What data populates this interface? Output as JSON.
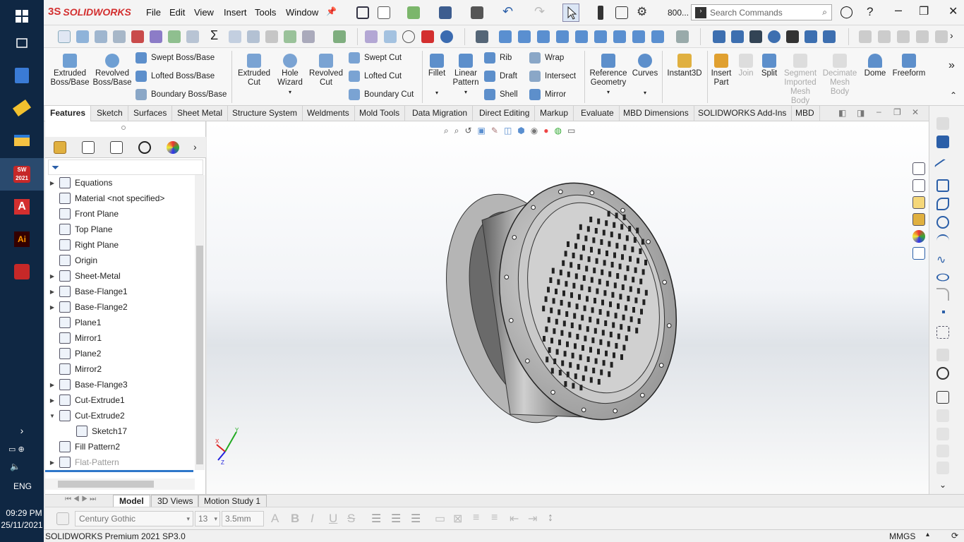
{
  "app": {
    "brand": "SOLIDWORKS",
    "edition_status": "SOLIDWORKS Premium 2021 SP3.0"
  },
  "menu": [
    "File",
    "Edit",
    "View",
    "Insert",
    "Tools",
    "Window"
  ],
  "titlebar": {
    "zoom": "800...",
    "search_placeholder": "Search Commands"
  },
  "ribbon": {
    "extruded_boss": "Extruded Boss/Base",
    "revolved_boss": "Revolved Boss/Base",
    "swept_boss": "Swept Boss/Base",
    "lofted_boss": "Lofted Boss/Base",
    "boundary_boss": "Boundary Boss/Base",
    "extruded_cut": "Extruded Cut",
    "hole_wizard": "Hole Wizard",
    "revolved_cut": "Revolved Cut",
    "swept_cut": "Swept Cut",
    "lofted_cut": "Lofted Cut",
    "boundary_cut": "Boundary Cut",
    "fillet": "Fillet",
    "linear_pattern": "Linear Pattern",
    "rib": "Rib",
    "draft": "Draft",
    "shell": "Shell",
    "wrap": "Wrap",
    "intersect": "Intersect",
    "mirror": "Mirror",
    "reference_geometry": "Reference Geometry",
    "curves": "Curves",
    "instant3d": "Instant3D",
    "insert_part": "Insert Part",
    "join": "Join",
    "split": "Split",
    "segment_mesh": "Segment Imported Mesh Body",
    "decimate_mesh": "Decimate Mesh Body",
    "dome": "Dome",
    "freeform": "Freeform"
  },
  "tabs": [
    "Features",
    "Sketch",
    "Surfaces",
    "Sheet Metal",
    "Structure System",
    "Weldments",
    "Mold Tools",
    "Data Migration",
    "Direct Editing",
    "Markup",
    "Evaluate",
    "MBD Dimensions",
    "SOLIDWORKS Add-Ins",
    "MBD"
  ],
  "tree": [
    {
      "label": "Equations",
      "expand": true
    },
    {
      "label": "Material <not specified>",
      "expand": false
    },
    {
      "label": "Front Plane",
      "expand": false
    },
    {
      "label": "Top Plane",
      "expand": false
    },
    {
      "label": "Right Plane",
      "expand": false
    },
    {
      "label": "Origin",
      "expand": false
    },
    {
      "label": "Sheet-Metal",
      "expand": true
    },
    {
      "label": "Base-Flange1",
      "expand": true
    },
    {
      "label": "Base-Flange2",
      "expand": true
    },
    {
      "label": "Plane1",
      "expand": false
    },
    {
      "label": "Mirror1",
      "expand": false
    },
    {
      "label": "Plane2",
      "expand": false
    },
    {
      "label": "Mirror2",
      "expand": false
    },
    {
      "label": "Base-Flange3",
      "expand": true
    },
    {
      "label": "Cut-Extrude1",
      "expand": true
    },
    {
      "label": "Cut-Extrude2",
      "expand": "open"
    },
    {
      "label": "Sketch17",
      "expand": false,
      "child": true
    },
    {
      "label": "Fill Pattern2",
      "expand": false
    },
    {
      "label": "Flat-Pattern",
      "expand": true,
      "dim": true
    }
  ],
  "bottom_tabs": [
    "Model",
    "3D Views",
    "Motion Study 1"
  ],
  "format": {
    "font": "Century Gothic",
    "size": "13",
    "height": "3.5mm"
  },
  "status_units": "MMGS",
  "clock": {
    "time": "09:29 PM",
    "date": "25/11/2021",
    "lang": "ENG"
  },
  "taskbar_labels": {
    "sw": "SW 2021"
  }
}
